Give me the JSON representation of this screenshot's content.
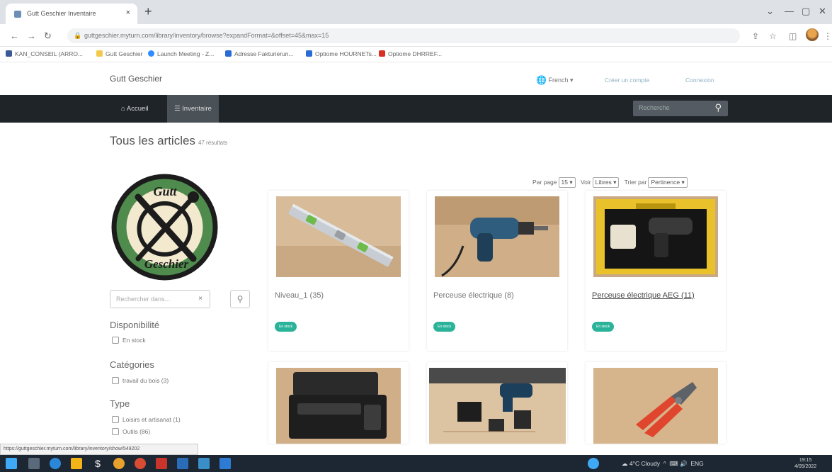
{
  "browser": {
    "tab_title": "Gutt Geschier Inventaire",
    "tab_close": "×",
    "new_tab": "+",
    "url": "guttgeschier.myturn.com/library/inventory/browse?expandFormat=&offset=45&max=15",
    "bookmarks": [
      {
        "label": "KAN_CONSEIL (ARRO...",
        "color": "#3b5998"
      },
      {
        "label": "Gutt Geschier",
        "color": "#f2c94c"
      },
      {
        "label": "Launch Meeting - Z...",
        "color": "#2d8cff"
      },
      {
        "label": "Adresse Fakturierun...",
        "color": "#2a6bd6"
      },
      {
        "label": "Optiome HOURNETs...",
        "color": "#2a6bd6"
      },
      {
        "label": "Optiome DHRREF...",
        "color": "#d93025"
      }
    ],
    "status_url": "https://guttgeschier.myturn.com/library/inventory/show/549202"
  },
  "site": {
    "brand": "Gutt Geschier",
    "language": "French",
    "create_account": "Créer un compte",
    "login": "Connexion",
    "nav": {
      "home": "Accueil",
      "inventory": "Inventaire",
      "search_placeholder": "Recherche"
    }
  },
  "page": {
    "title": "Tous les articles",
    "result_count": "47 résultats",
    "controls": {
      "per_page_label": "Par page",
      "per_page_value": "15",
      "view_label": "Voir",
      "view_value": "Libres",
      "sort_label": "Trier par",
      "sort_value": "Pertinence"
    },
    "logo_text_top": "Gutt",
    "logo_text_bottom": "Geschier",
    "sidebar": {
      "search_placeholder": "Rechercher dans...",
      "clear": "×",
      "availability_title": "Disponibilité",
      "availability_options": [
        "En stock"
      ],
      "categories_title": "Catégories",
      "category_options": [
        "travail du bois (3)"
      ],
      "type_title": "Type",
      "type_options": [
        "Loisirs et artisanat (1)",
        "Outils (86)"
      ]
    },
    "items": [
      {
        "title": "Niveau_1 (35)",
        "badge": "En stock"
      },
      {
        "title": "Perceuse électrique (8)",
        "badge": "En stock"
      },
      {
        "title": "Perceuse électrique AEG (11)",
        "badge": "En stock"
      },
      {
        "title": "",
        "badge": ""
      },
      {
        "title": "",
        "badge": ""
      },
      {
        "title": "",
        "badge": ""
      }
    ]
  },
  "taskbar": {
    "weather": "4°C Cloudy",
    "lang": "ENG",
    "time": "19:15",
    "date": "4/05/2022"
  }
}
